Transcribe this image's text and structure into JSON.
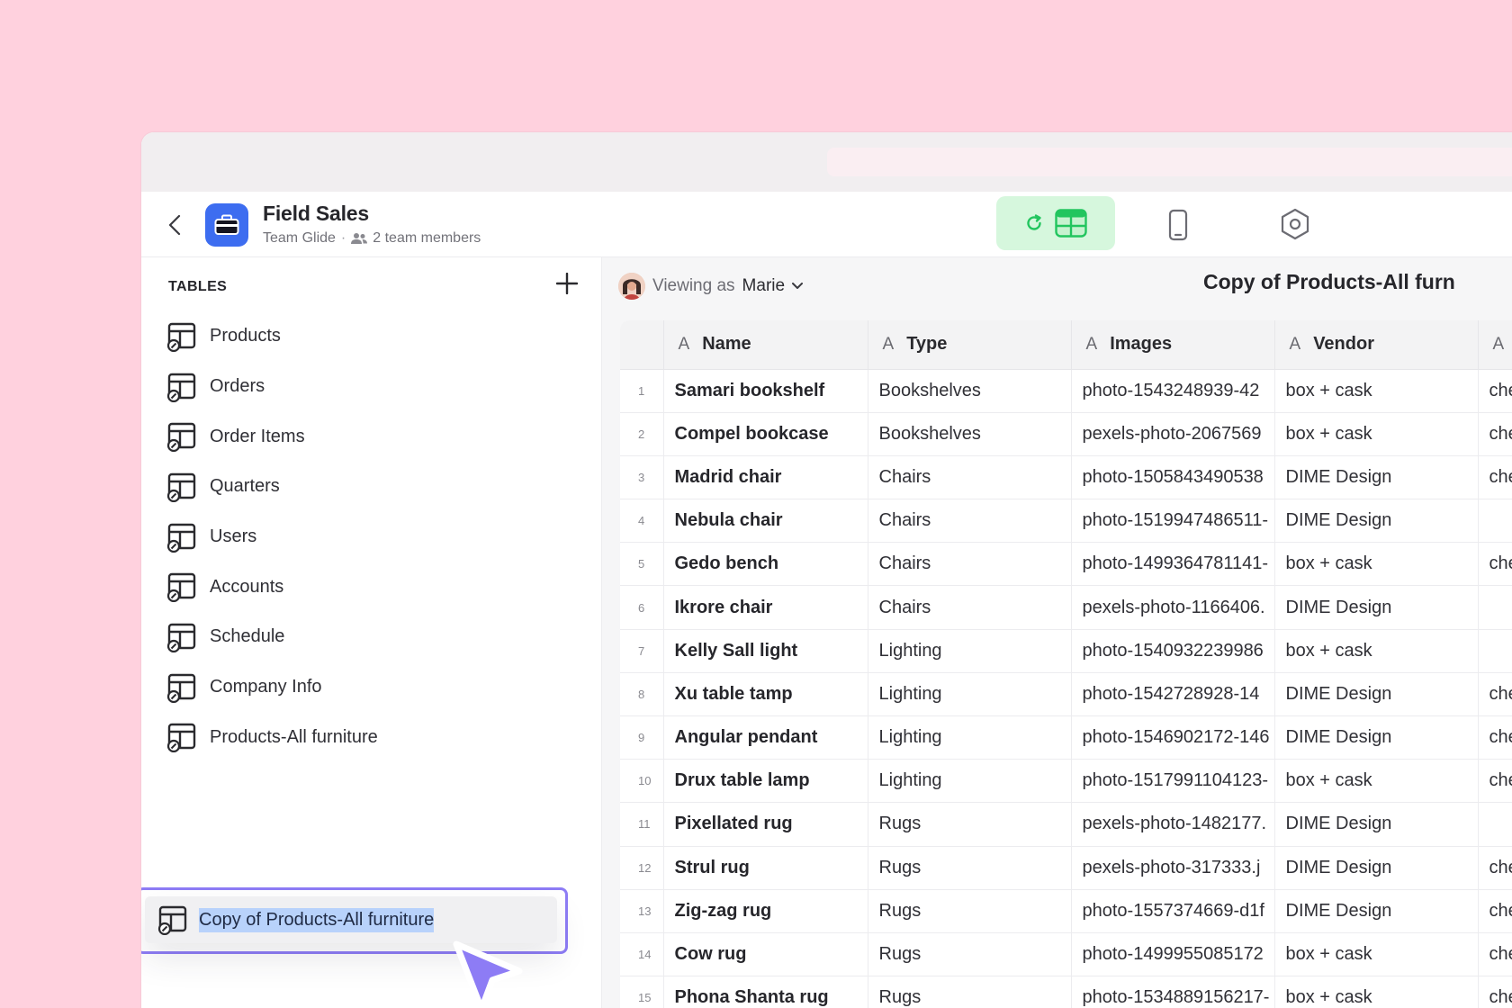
{
  "app": {
    "title": "Field Sales",
    "team": "Team Glide",
    "members": "2 team members"
  },
  "header_tabs": [
    {
      "icon": "refresh-icon"
    },
    {
      "icon": "data-grid-icon"
    },
    {
      "icon": "phone-icon"
    },
    {
      "icon": "settings-hexagon-icon"
    }
  ],
  "sidebar": {
    "heading": "TABLES",
    "items": [
      {
        "label": "Products"
      },
      {
        "label": "Orders"
      },
      {
        "label": "Order Items"
      },
      {
        "label": "Quarters"
      },
      {
        "label": "Users"
      },
      {
        "label": "Accounts"
      },
      {
        "label": "Schedule"
      },
      {
        "label": "Company Info"
      },
      {
        "label": "Products-All furniture"
      }
    ],
    "dragging_item": {
      "label": "Copy of Products-All furniture"
    }
  },
  "main": {
    "viewing_prefix": "Viewing as",
    "viewing_user": "Marie",
    "title": "Copy of Products-All furn"
  },
  "table": {
    "columns": [
      {
        "label": "Name",
        "type_glyph": "A"
      },
      {
        "label": "Type",
        "type_glyph": "A"
      },
      {
        "label": "Images",
        "type_glyph": "A"
      },
      {
        "label": "Vendor",
        "type_glyph": "A"
      },
      {
        "label": "",
        "type_glyph": "A"
      }
    ],
    "rows": [
      {
        "n": "1",
        "name": "Samari bookshelf",
        "type": "Bookshelves",
        "image": "photo-1543248939-42",
        "vendor": "box + cask",
        "extra": "che"
      },
      {
        "n": "2",
        "name": "Compel bookcase",
        "type": "Bookshelves",
        "image": "pexels-photo-2067569",
        "vendor": "box + cask",
        "extra": "che"
      },
      {
        "n": "3",
        "name": "Madrid chair",
        "type": "Chairs",
        "image": "photo-1505843490538",
        "vendor": "DIME Design",
        "extra": "che"
      },
      {
        "n": "4",
        "name": "Nebula chair",
        "type": "Chairs",
        "image": "photo-1519947486511-",
        "vendor": "DIME Design",
        "extra": ""
      },
      {
        "n": "5",
        "name": "Gedo bench",
        "type": "Chairs",
        "image": "photo-1499364781141-",
        "vendor": "box + cask",
        "extra": "che"
      },
      {
        "n": "6",
        "name": "Ikrore chair",
        "type": "Chairs",
        "image": "pexels-photo-1166406.",
        "vendor": "DIME Design",
        "extra": ""
      },
      {
        "n": "7",
        "name": "Kelly Sall light",
        "type": "Lighting",
        "image": "photo-1540932239986",
        "vendor": "box + cask",
        "extra": ""
      },
      {
        "n": "8",
        "name": "Xu table tamp",
        "type": "Lighting",
        "image": "photo-1542728928-14",
        "vendor": "DIME Design",
        "extra": "che"
      },
      {
        "n": "9",
        "name": "Angular pendant",
        "type": "Lighting",
        "image": "photo-1546902172-146",
        "vendor": "DIME Design",
        "extra": "che"
      },
      {
        "n": "10",
        "name": "Drux table lamp",
        "type": "Lighting",
        "image": "photo-1517991104123-",
        "vendor": "box + cask",
        "extra": "che"
      },
      {
        "n": "11",
        "name": "Pixellated rug",
        "type": "Rugs",
        "image": "pexels-photo-1482177.",
        "vendor": "DIME Design",
        "extra": ""
      },
      {
        "n": "12",
        "name": "Strul rug",
        "type": "Rugs",
        "image": "pexels-photo-317333.j",
        "vendor": "DIME Design",
        "extra": "che"
      },
      {
        "n": "13",
        "name": "Zig-zag rug",
        "type": "Rugs",
        "image": "photo-1557374669-d1f",
        "vendor": "DIME Design",
        "extra": "che"
      },
      {
        "n": "14",
        "name": "Cow rug",
        "type": "Rugs",
        "image": "photo-1499955085172",
        "vendor": "box + cask",
        "extra": "che"
      },
      {
        "n": "15",
        "name": "Phona Shanta rug",
        "type": "Rugs",
        "image": "photo-1534889156217-",
        "vendor": "box + cask",
        "extra": "che"
      }
    ]
  },
  "colors": {
    "background": "#ffd1de",
    "app_icon": "#3d6df0",
    "accent_green": "#22c55e",
    "drag_outline": "#8d7cf5",
    "selection": "#b8d2fb"
  }
}
